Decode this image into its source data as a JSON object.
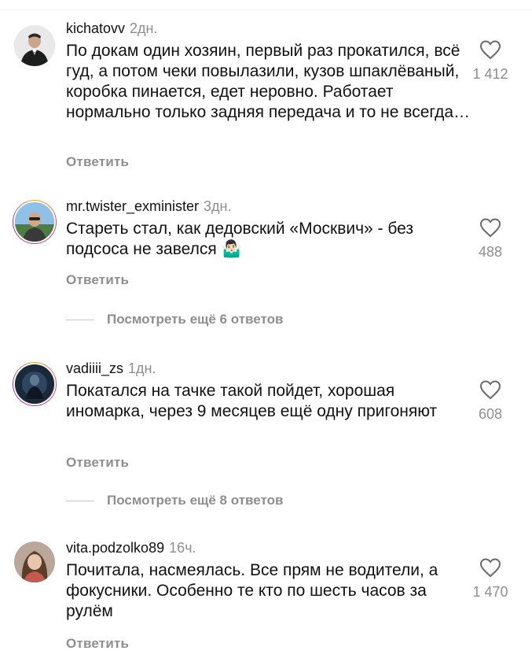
{
  "comments": [
    {
      "username": "kichatovv",
      "time": "2дн.",
      "text": "По докам один хозяин, первый раз прокатился, всё гуд, а потом чеки повылазили, кузов шпаклёваный, коробка пинается, едет неровно. Работает нормально только задняя передача и то не всегда…",
      "likes": "1 412",
      "reply_label": "Ответить"
    },
    {
      "username": "mr.twister_exminister",
      "time": "3дн.",
      "text": "Стареть стал, как дедовский «Москвич» - без подсоса не завелся",
      "emoji": "🤷🏻‍♂️",
      "likes": "488",
      "reply_label": "Ответить",
      "view_replies": "Посмотреть ещё 6 ответов"
    },
    {
      "username": "vadiiii_zs",
      "time": "1дн.",
      "text": "Покатался на тачке такой пойдет, хорошая иномарка, через 9 месяцев ещё одну пригоняют",
      "likes": "608",
      "reply_label": "Ответить",
      "view_replies": "Посмотреть ещё 8 ответов"
    },
    {
      "username": "vita.podzolko89",
      "time": "16ч.",
      "text": "Почитала, насмеялась. Все прям не водители, а фокусники. Особенно те кто по шесть часов за рулём",
      "likes": "1 470",
      "reply_label": "Ответить"
    }
  ],
  "icons": {
    "like": "heart-outline-icon"
  },
  "colors": {
    "text": "#111111",
    "secondary": "#8e8e8e",
    "story_ring": "#e4405f"
  }
}
